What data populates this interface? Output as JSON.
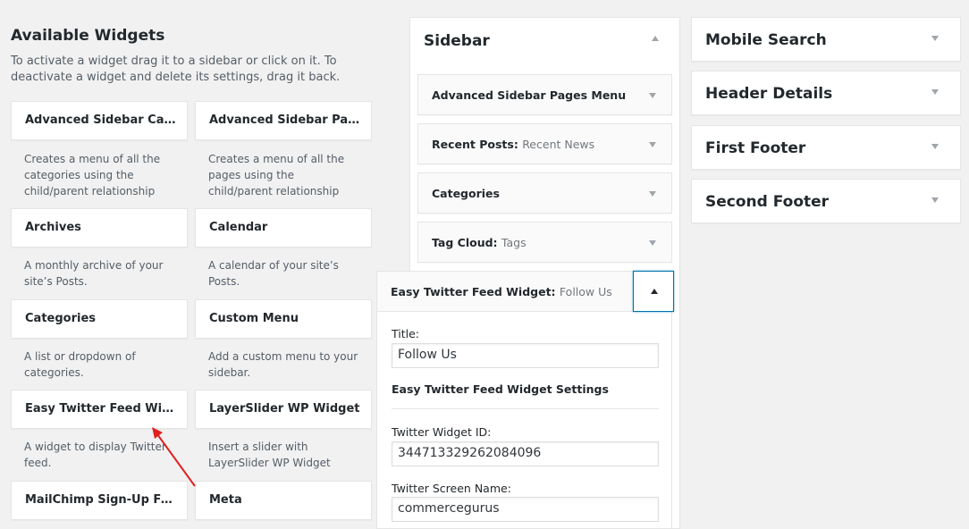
{
  "available": {
    "title": "Available Widgets",
    "description": "To activate a widget drag it to a sidebar or click on it. To deactivate a widget and delete its settings, drag it back.",
    "widgets": [
      {
        "name": "Advanced Sidebar Categ...",
        "desc": "Creates a menu of all the categories using the child/parent relationship"
      },
      {
        "name": "Advanced Sidebar Pages...",
        "desc": "Creates a menu of all the pages using the child/parent relationship"
      },
      {
        "name": "Archives",
        "desc": "A monthly archive of your site’s Posts."
      },
      {
        "name": "Calendar",
        "desc": "A calendar of your site’s Posts."
      },
      {
        "name": "Categories",
        "desc": "A list or dropdown of categories."
      },
      {
        "name": "Custom Menu",
        "desc": "Add a custom menu to your sidebar."
      },
      {
        "name": "Easy Twitter Feed Widget",
        "desc": "A widget to display Twitter feed."
      },
      {
        "name": "LayerSlider WP Widget",
        "desc": "Insert a slider with LayerSlider WP Widget"
      },
      {
        "name": "MailChimp Sign-Up Form",
        "desc": ""
      },
      {
        "name": "Meta",
        "desc": ""
      }
    ]
  },
  "sidebar": {
    "title": "Sidebar",
    "items": [
      {
        "name": "Advanced Sidebar Pages Menu",
        "sub": ""
      },
      {
        "name": "Recent Posts:",
        "sub": "Recent News"
      },
      {
        "name": "Categories",
        "sub": ""
      },
      {
        "name": "Tag Cloud:",
        "sub": "Tags"
      }
    ],
    "expanded": {
      "name": "Easy Twitter Feed Widget:",
      "sub": "Follow Us",
      "title_label": "Title:",
      "title_value": "Follow Us",
      "settings_heading": "Easy Twitter Feed Widget Settings",
      "widget_id_label": "Twitter Widget ID:",
      "widget_id_value": "344713329262084096",
      "screen_name_label": "Twitter Screen Name:",
      "screen_name_value": "commercegurus"
    }
  },
  "other_areas": [
    {
      "title": "Mobile Search"
    },
    {
      "title": "Header Details"
    },
    {
      "title": "First Footer"
    },
    {
      "title": "Second Footer"
    }
  ],
  "colors": {
    "background": "#f1f1f1",
    "focus_border": "#0073aa",
    "annotation_arrow": "#e02020"
  }
}
